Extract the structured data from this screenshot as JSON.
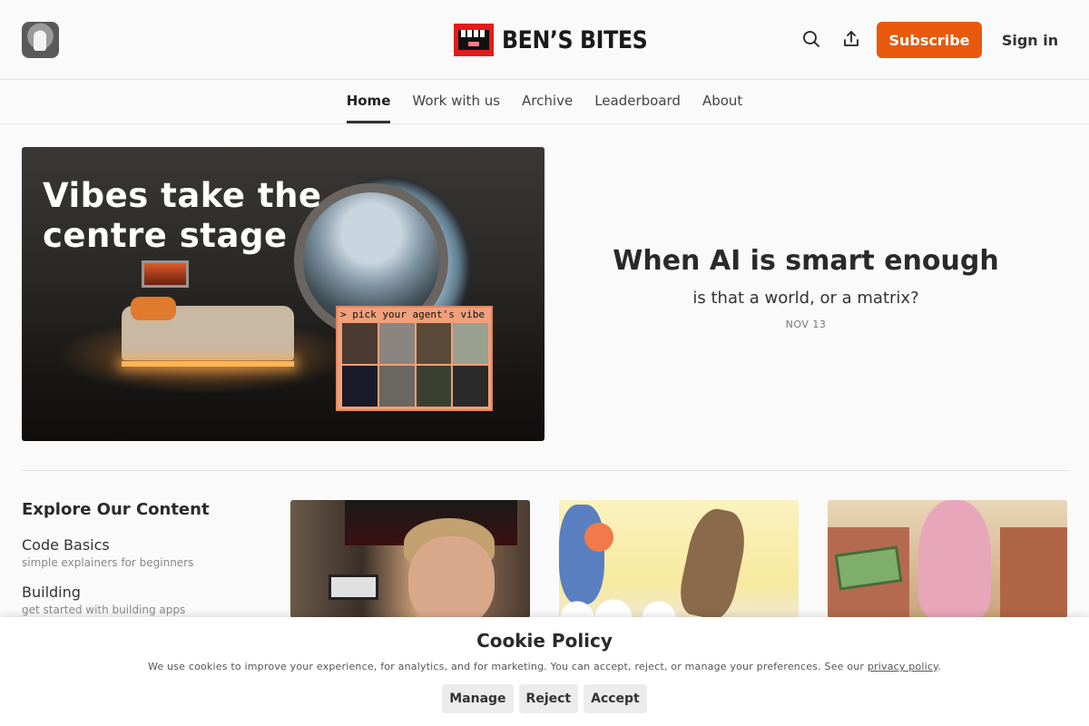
{
  "header": {
    "brand_name": "BEN’S BITES",
    "subscribe_label": "Subscribe",
    "signin_label": "Sign in",
    "accent_color": "#e8590c",
    "logo_color": "#e21b1b",
    "icons": [
      "search-icon",
      "share-icon"
    ]
  },
  "nav": {
    "items": [
      {
        "label": "Home",
        "active": true
      },
      {
        "label": "Work with us",
        "active": false
      },
      {
        "label": "Archive",
        "active": false
      },
      {
        "label": "Leaderboard",
        "active": false
      },
      {
        "label": "About",
        "active": false
      }
    ]
  },
  "hero": {
    "image_title": "Vibes take the centre stage",
    "image_overlay_label": "> pick your agent's vibe",
    "post_title": "When AI is smart enough",
    "post_subtitle": "is that a world, or a matrix?",
    "post_date": "NOV 13"
  },
  "explore": {
    "title": "Explore Our Content",
    "items": [
      {
        "name": "Code Basics",
        "desc": "simple explainers for beginners"
      },
      {
        "name": "Building",
        "desc": "get started with building apps"
      }
    ]
  },
  "cookie": {
    "title": "Cookie Policy",
    "text": "We use cookies to improve your experience, for analytics, and for marketing. You can accept, reject, or manage your preferences. See our ",
    "link_label": "privacy policy",
    "text_end": ".",
    "buttons": {
      "manage": "Manage",
      "reject": "Reject",
      "accept": "Accept"
    }
  }
}
